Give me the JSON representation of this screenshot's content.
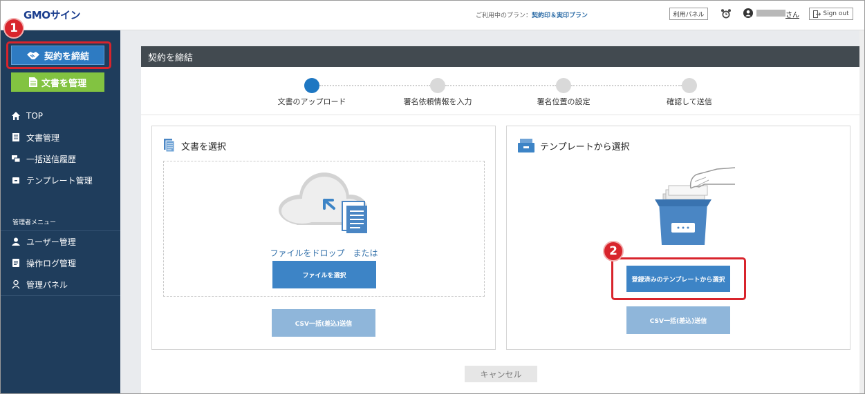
{
  "header": {
    "logo": "GMOサイン",
    "plan_label": "ご利用中のプラン：",
    "plan_name": "契約印＆実印プラン",
    "panel_button": "利用パネル",
    "user_suffix": "さん",
    "signout_button": "Sign out"
  },
  "sidebar": {
    "contract_button": "契約を締結",
    "docs_button": "文書を管理",
    "items": [
      {
        "label": "TOP",
        "icon": "home-icon"
      },
      {
        "label": "文書管理",
        "icon": "document-list-icon"
      },
      {
        "label": "一括送信履歴",
        "icon": "batch-send-icon"
      },
      {
        "label": "テンプレート管理",
        "icon": "template-box-icon"
      }
    ],
    "admin_section": "管理者メニュー",
    "admin_items": [
      {
        "label": "ユーザー管理",
        "icon": "user-icon"
      },
      {
        "label": "操作ログ管理",
        "icon": "log-icon"
      },
      {
        "label": "管理パネル",
        "icon": "admin-panel-icon"
      }
    ]
  },
  "main": {
    "title": "契約を締結",
    "steps": [
      {
        "label": "文書のアップロード",
        "active": true
      },
      {
        "label": "署名依頼情報を入力",
        "active": false
      },
      {
        "label": "署名位置の設定",
        "active": false
      },
      {
        "label": "確認して送信",
        "active": false
      }
    ],
    "left_card": {
      "title": "文書を選択",
      "drop_text": "ファイルをドロップ　または",
      "select_button": "ファイルを選択",
      "csv_button": "CSV一括(差込)送信"
    },
    "right_card": {
      "title": "テンプレートから選択",
      "template_button": "登録済みのテンプレートから選択",
      "csv_button": "CSV一括(差込)送信"
    },
    "cancel_button": "キャンセル"
  },
  "callouts": {
    "first": "1",
    "second": "2"
  },
  "colors": {
    "sidebar_bg": "#1f3d5c",
    "primary_blue": "#3d84c6",
    "green": "#82c341",
    "callout_red": "#d8242c",
    "titlebar_bg": "#424a50"
  }
}
